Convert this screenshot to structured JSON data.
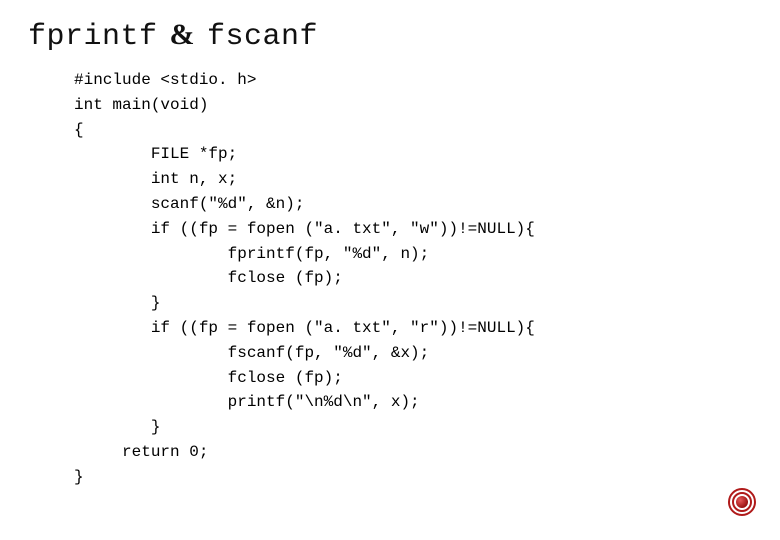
{
  "title": {
    "part1": "fprintf",
    "amp": "&",
    "part2": "fscanf"
  },
  "code": "#include <stdio. h>\nint main(void)\n{\n        FILE *fp;\n        int n, x;\n        scanf(\"%d\", &n);\n        if ((fp = fopen (\"a. txt\", \"w\"))!=NULL){\n                fprintf(fp, \"%d\", n);\n                fclose (fp);\n        }\n        if ((fp = fopen (\"a. txt\", \"r\"))!=NULL){\n                fscanf(fp, \"%d\", &x);\n                fclose (fp);\n                printf(\"\\n%d\\n\", x);\n        }\n     return 0;\n}"
}
